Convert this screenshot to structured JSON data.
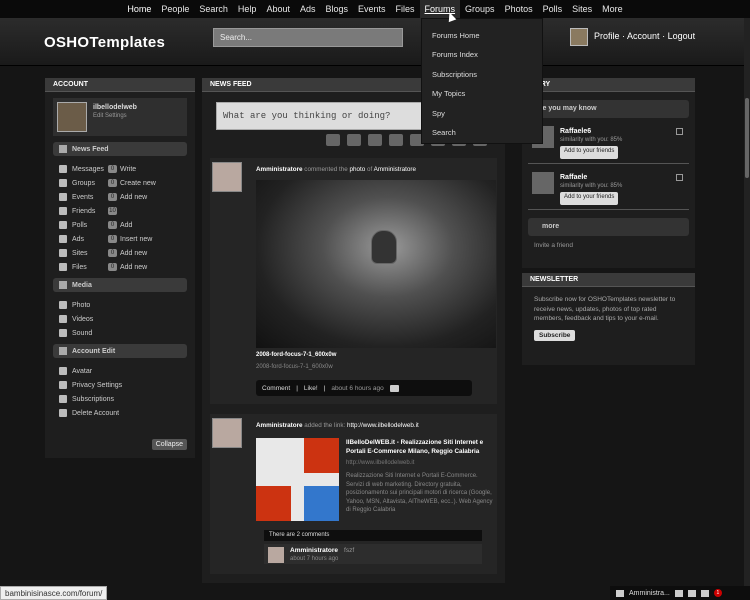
{
  "nav": {
    "items": [
      "Home",
      "People",
      "Search",
      "Help",
      "About",
      "Ads",
      "Blogs",
      "Events",
      "Files",
      "Forums",
      "Groups",
      "Photos",
      "Polls",
      "Sites",
      "More"
    ]
  },
  "header": {
    "logo": "OSHOTemplates",
    "search_placeholder": "Search...",
    "user_links": [
      "Profile",
      "Account",
      "Logout"
    ]
  },
  "forums_menu": {
    "items": [
      "Forums Home",
      "Forums Index",
      "Subscriptions",
      "My Topics",
      "Spy",
      "Search"
    ]
  },
  "left": {
    "title": "ACCOUNT",
    "profile": {
      "name": "ilbellodelweb",
      "edit": "Edit Settings"
    },
    "news_feed_label": "News Feed",
    "feed_rows": [
      {
        "label": "Messages",
        "count": "0",
        "action": "Write"
      },
      {
        "label": "Groups",
        "count": "0",
        "action": "Create new"
      },
      {
        "label": "Events",
        "count": "0",
        "action": "Add new"
      },
      {
        "label": "Friends",
        "count": "10",
        "action": ""
      },
      {
        "label": "Polls",
        "count": "0",
        "action": "Add"
      },
      {
        "label": "Ads",
        "count": "0",
        "action": "Insert new"
      },
      {
        "label": "Sites",
        "count": "0",
        "action": "Add new"
      },
      {
        "label": "Files",
        "count": "0",
        "action": "Add new"
      }
    ],
    "media_label": "Media",
    "media_rows": [
      "Photo",
      "Videos",
      "Sound"
    ],
    "account_edit_label": "Account Edit",
    "account_rows": [
      "Avatar",
      "Privacy Settings",
      "Subscriptions",
      "Delete Account"
    ],
    "collapse": "Collapse"
  },
  "middle": {
    "title": "NEWS FEED",
    "status_placeholder": "What are you thinking or doing?",
    "post1": {
      "who": "Amministratore",
      "mid": "commented the",
      "obj": "photo",
      "of": "of",
      "target": "Amministratore",
      "photo_title": "2008-ford-focus-7-1_600x0w",
      "photo_sub": "2008-ford-focus-7-1_600x0w",
      "comment": "Comment",
      "like": "Like!",
      "time": "about 6 hours ago"
    },
    "post2": {
      "who": "Amministratore",
      "mid": "added the link:",
      "url": "http://www.ilbellodelweb.it",
      "link_title": "IlBelloDelWEB.it - Realizzazione Siti Internet e Portali E-Commerce Milano, Reggio Calabria",
      "link_url": "http://www.ilbellodelweb.it",
      "link_desc": "Realizzazione Siti Internet e Portali E-Commerce. Servizi di web marketing. Directory gratuita, posizionamento sui principali motori di ricerca (Google, Yahoo, MSN, Altavista, AlTheWEB, ecc..). Web Agency di Reggio Calabria",
      "comments_head": "There are 2 comments",
      "comment_name": "Amministratore",
      "comment_text": "fszf",
      "comment_time": "about 7 hours ago"
    }
  },
  "right": {
    "title": "MMARY",
    "pymk": "ople you may know",
    "people": [
      {
        "name": "Raffaele6",
        "sim": "similarity with you: 85%",
        "add": "Add to your friends"
      },
      {
        "name": "Raffaele",
        "sim": "similarity with you: 85%",
        "add": "Add to your friends"
      }
    ],
    "more": "more",
    "invite": "Invite a friend"
  },
  "newsletter": {
    "title": "NEWSLETTER",
    "text": "Subscribe now for OSHOTemplates newsletter to receive news, updates, photos of top rated members, feedback and tips to your e-mail.",
    "button": "Subscribe"
  },
  "statusbar": {
    "url": "bambinisinasce.com/forum/"
  },
  "chatbar": {
    "user": "Amministra...",
    "notif": "1"
  }
}
